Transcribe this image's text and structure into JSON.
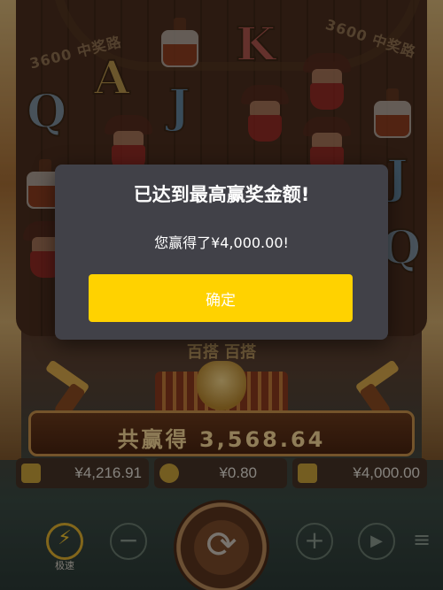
{
  "game": {
    "ways_badge_left": "3600 中奖路",
    "ways_badge_right": "3600 中奖路",
    "ribbon_text": "百搭 百搭",
    "total_win_label": "共赢得",
    "total_win_value": "3,568.64",
    "symbols": [
      "Q",
      "A",
      "J",
      "K",
      "Q",
      "J",
      "Q"
    ],
    "balance": "¥4,216.91",
    "bet": "¥0.80",
    "last_win": "¥4,000.00",
    "turbo_label": "极速"
  },
  "dialog": {
    "title": "已达到最高赢奖金额!",
    "message": "您赢得了¥4,000.00!",
    "confirm_label": "确定"
  },
  "colors": {
    "dialog_bg": "#414148",
    "confirm_bg": "#ffd200",
    "confirm_text": "#ffffff"
  },
  "icons": {
    "turbo": "lightning-icon",
    "minus": "minus-icon",
    "plus": "plus-icon",
    "spin": "spin-arrows-icon",
    "autoplay": "autoplay-icon",
    "menu": "menu-icon"
  }
}
